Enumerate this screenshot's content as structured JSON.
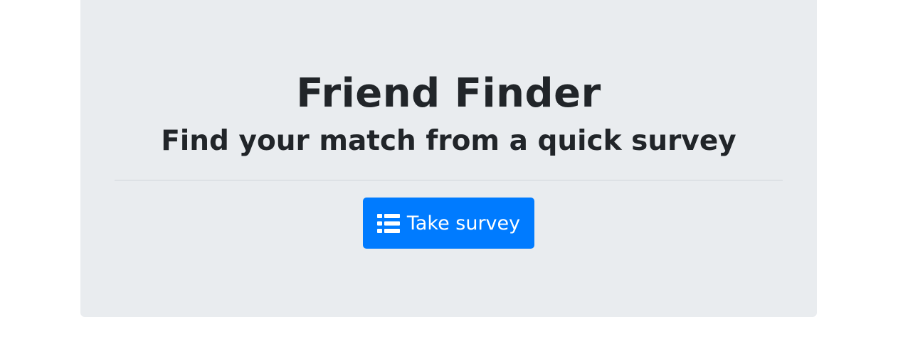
{
  "hero": {
    "title": "Friend Finder",
    "subtitle": "Find your match from a quick survey",
    "cta": {
      "label": "Take survey",
      "icon": "list-icon"
    }
  },
  "colors": {
    "background": "#ffffff",
    "panel": "#e9ecef",
    "text": "#212529",
    "primary": "#007bff",
    "primary_text": "#ffffff"
  }
}
